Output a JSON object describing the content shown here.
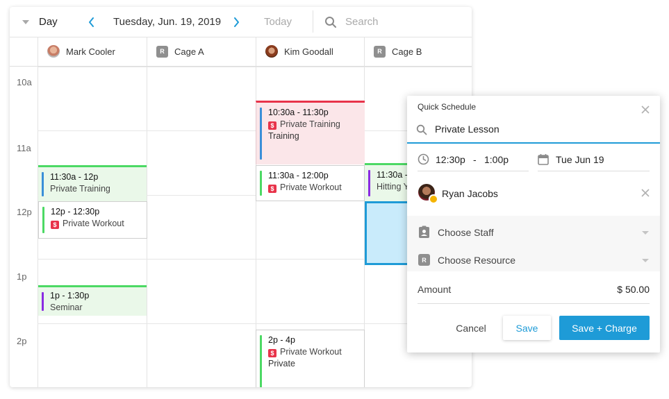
{
  "toolbar": {
    "view_label": "Day",
    "date_label": "Tuesday, Jun. 19, 2019",
    "today_label": "Today",
    "search_placeholder": "Search"
  },
  "columns": [
    {
      "name": "Mark Cooler",
      "kind": "staff"
    },
    {
      "name": "Cage A",
      "kind": "resource",
      "badge": "R"
    },
    {
      "name": "Kim Goodall",
      "kind": "staff"
    },
    {
      "name": "Cage B",
      "kind": "resource",
      "badge": "R"
    }
  ],
  "time_labels": [
    "10a",
    "11a",
    "12p",
    "1p",
    "2p"
  ],
  "events": {
    "kim_training": {
      "time": "10:30a - 11:30p",
      "title": "Private Training",
      "extra": "Training"
    },
    "mark_training": {
      "time": "11:30a - 12p",
      "title": "Private Training"
    },
    "kim_workout": {
      "time": "11:30a - 12:00p",
      "title": "Private Workout"
    },
    "cageb_hitting": {
      "time": "11:30a -",
      "title": "Hitting Y"
    },
    "mark_workout": {
      "time": "12p - 12:30p",
      "title": "Private Workout"
    },
    "mark_seminar": {
      "time": "1p - 1:30p",
      "title": "Seminar"
    },
    "kim_workout2": {
      "time": "2p - 4p",
      "title": "Private Workout",
      "extra": "Private"
    }
  },
  "quick_schedule": {
    "title": "Quick Schedule",
    "search_value": "Private Lesson",
    "start_time": "12:30p",
    "time_separator": "-",
    "end_time": "1:00p",
    "date": "Tue Jun 19",
    "client_name": "Ryan Jacobs",
    "staff_placeholder": "Choose Staff",
    "resource_placeholder": "Choose Resource",
    "resource_badge": "R",
    "amount_label": "Amount",
    "amount_value": "$ 50.00",
    "cancel_label": "Cancel",
    "save_label": "Save",
    "save_charge_label": "Save + Charge"
  },
  "colors": {
    "accent": "#1e9bd7",
    "event_green_bg": "#eaf8e9",
    "event_green_border": "#4cd964",
    "event_pink_bg": "#fbe6e9",
    "event_pink_border": "#e8334a",
    "selection_bg": "#c9ebfb",
    "dollar_badge": "#e8334a"
  },
  "icons": {
    "view_dropdown": "chevron-down-icon",
    "prev": "chevron-left-icon",
    "next": "chevron-right-icon",
    "search": "search-icon",
    "close": "close-icon",
    "clock": "clock-icon",
    "calendar": "calendar-icon",
    "staff": "staff-badge-icon",
    "money": "dollar-icon"
  }
}
